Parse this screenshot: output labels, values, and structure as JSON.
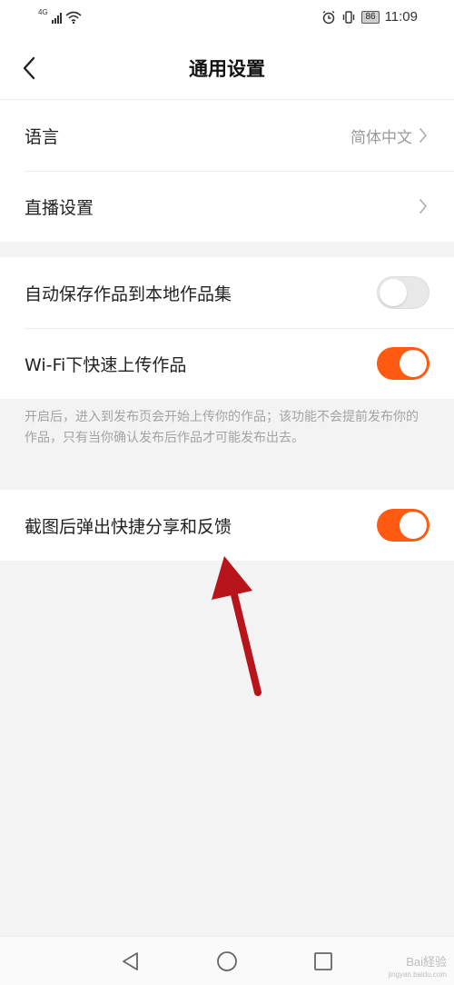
{
  "status_bar": {
    "network_type": "4G",
    "alarm_icon": "alarm-clock-icon",
    "vibrate_icon": "vibrate-icon",
    "battery": "86",
    "time": "11:09"
  },
  "header": {
    "title": "通用设置",
    "back_icon": "chevron-left-icon"
  },
  "group1": {
    "language": {
      "label": "语言",
      "value": "简体中文"
    },
    "live": {
      "label": "直播设置"
    }
  },
  "group2": {
    "auto_save": {
      "label": "自动保存作品到本地作品集",
      "enabled": false
    },
    "wifi_upload": {
      "label": "Wi-Fi下快速上传作品",
      "enabled": true
    }
  },
  "note": "开启后，进入到发布页会开始上传你的作品；该功能不会提前发布你的作品，只有当你确认发布后作品才可能发布出去。",
  "group3": {
    "screenshot_share": {
      "label": "截图后弹出快捷分享和反馈",
      "enabled": true
    }
  },
  "colors": {
    "accent": "#ff5a12",
    "annotation_arrow": "#b8141b"
  },
  "navbar": {
    "back": "triangle-back-icon",
    "home": "circle-home-icon",
    "recents": "square-recents-icon"
  },
  "watermark": {
    "text": "Bai経验",
    "url": "jingyan.baidu.com"
  }
}
